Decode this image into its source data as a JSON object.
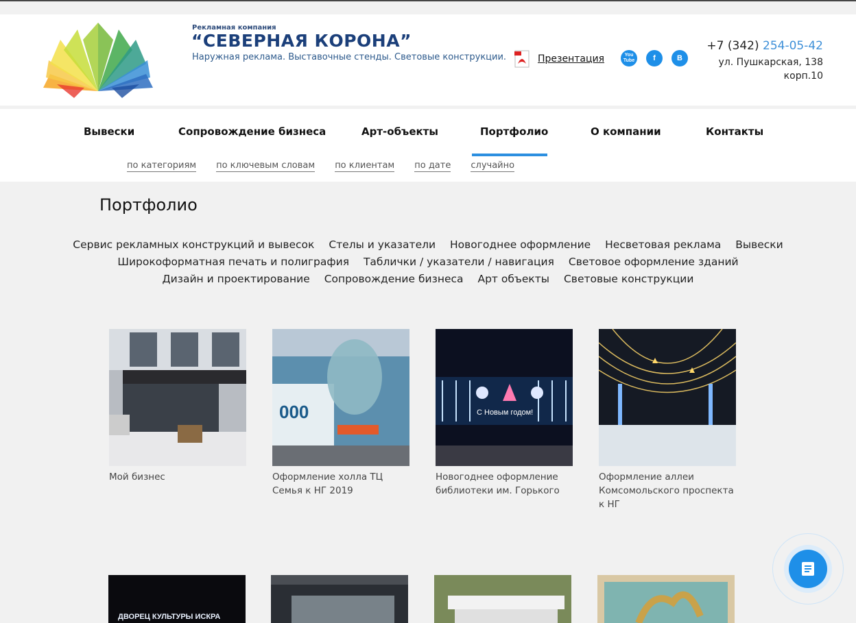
{
  "header": {
    "brand_small": "Рекламная компания",
    "brand_title": "“СЕВЕРНАЯ КОРОНА”",
    "tagline": "Наружная реклама. Выставочные стенды. Световые конструкции.",
    "presentation_label": "Презентация",
    "socials": [
      "You Tube",
      "f",
      "B"
    ],
    "phone_prefix": "+7 (342) ",
    "phone_number": "254-05-42",
    "address_line1": "ул. Пушкарская, 138",
    "address_line2": "корп.10"
  },
  "nav": {
    "items": [
      "Вывески",
      "Сопровождение бизнеса",
      "Арт-объекты",
      "Портфолио",
      "О компании",
      "Контакты"
    ],
    "active": "Портфолио",
    "subnav": [
      "по категориям",
      "по ключевым словам",
      "по клиентам",
      "по дате",
      "случайно"
    ]
  },
  "page": {
    "title": "Портфолио",
    "categories": [
      [
        "Сервис рекламных конструкций и вывесок",
        "Стелы и указатели",
        "Новогоднее оформление",
        "Несветовая реклама",
        "Вывески"
      ],
      [
        "Широкоформатная печать и полиграфия",
        "Таблички / указатели / навигация",
        "Световое оформление зданий"
      ],
      [
        "Дизайн и проектирование",
        "Сопровождение бизнеса",
        "Арт объекты",
        "Световые конструкции"
      ]
    ]
  },
  "portfolio": [
    {
      "caption": "Мой бизнес"
    },
    {
      "caption": "Оформление холла ТЦ Семья к НГ 2019"
    },
    {
      "caption": "Новогоднее оформление библиотеки им. Горького"
    },
    {
      "caption": "Оформление аллеи Комсомольского проспекта к НГ"
    }
  ],
  "thumbs": {
    "second_row_text": "ДВОРЕЦ КУЛЬТУРЫ ИСКРА",
    "ooo_text": "000",
    "newyear_text": "С Новым годом!"
  },
  "colors": {
    "accent": "#2c8fe0",
    "brand": "#1b3f7a",
    "fab": "#1e8fe8"
  }
}
